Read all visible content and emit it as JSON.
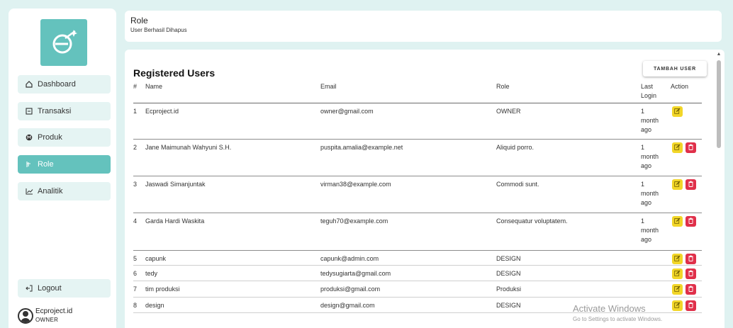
{
  "sidebar": {
    "logo_alt": "ecproject",
    "items": [
      {
        "label": "Dashboard",
        "icon": "home-icon",
        "active": false
      },
      {
        "label": "Transaksi",
        "icon": "receipt-icon",
        "active": false
      },
      {
        "label": "Produk",
        "icon": "product-icon",
        "active": false
      },
      {
        "label": "Role",
        "icon": "role-icon",
        "active": true
      },
      {
        "label": "Analitik",
        "icon": "chart-icon",
        "active": false
      }
    ],
    "logout_label": "Logout",
    "user": {
      "name": "Ecproject.id",
      "role": "OWNER"
    }
  },
  "header": {
    "title": "Role",
    "message": "User Berhasil Dihapus"
  },
  "main": {
    "title": "Registered Users",
    "add_button": "TAMBAH USER",
    "columns": {
      "num": "#",
      "name": "Name",
      "email": "Email",
      "role": "Role",
      "last_login": "Last\nLogin",
      "action": "Action"
    },
    "rows": [
      {
        "num": "1",
        "name": "Ecproject.id",
        "email": "owner@gmail.com",
        "role": "OWNER",
        "last_login": "1\nmonth\nago",
        "deletable": false
      },
      {
        "num": "2",
        "name": "Jane Maimunah Wahyuni S.H.",
        "email": "puspita.amalia@example.net",
        "role": "Aliquid porro.",
        "last_login": "1\nmonth\nago",
        "deletable": true
      },
      {
        "num": "3",
        "name": "Jaswadi Simanjuntak",
        "email": "virman38@example.com",
        "role": "Commodi sunt.",
        "last_login": "1\nmonth\nago",
        "deletable": true
      },
      {
        "num": "4",
        "name": "Garda Hardi Waskita",
        "email": "teguh70@example.com",
        "role": "Consequatur voluptatem.",
        "last_login": "1\nmonth\nago",
        "deletable": true
      },
      {
        "num": "5",
        "name": "capunk",
        "email": "capunk@admin.com",
        "role": "DESIGN",
        "last_login": "",
        "deletable": true
      },
      {
        "num": "6",
        "name": "tedy",
        "email": "tedysugiarta@gmail.com",
        "role": "DESIGN",
        "last_login": "",
        "deletable": true
      },
      {
        "num": "7",
        "name": "tim produksi",
        "email": "produksi@gmail.com",
        "role": "Produksi",
        "last_login": "",
        "deletable": true
      },
      {
        "num": "8",
        "name": "design",
        "email": "design@gmail.com",
        "role": "DESIGN",
        "last_login": "",
        "deletable": true
      }
    ]
  },
  "watermark": {
    "line1": "Activate Windows",
    "line2": "Go to Settings to activate Windows."
  },
  "colors": {
    "background": "#dff2f1",
    "accent": "#64c2bd",
    "edit": "#f2d628",
    "delete": "#e0304a"
  }
}
